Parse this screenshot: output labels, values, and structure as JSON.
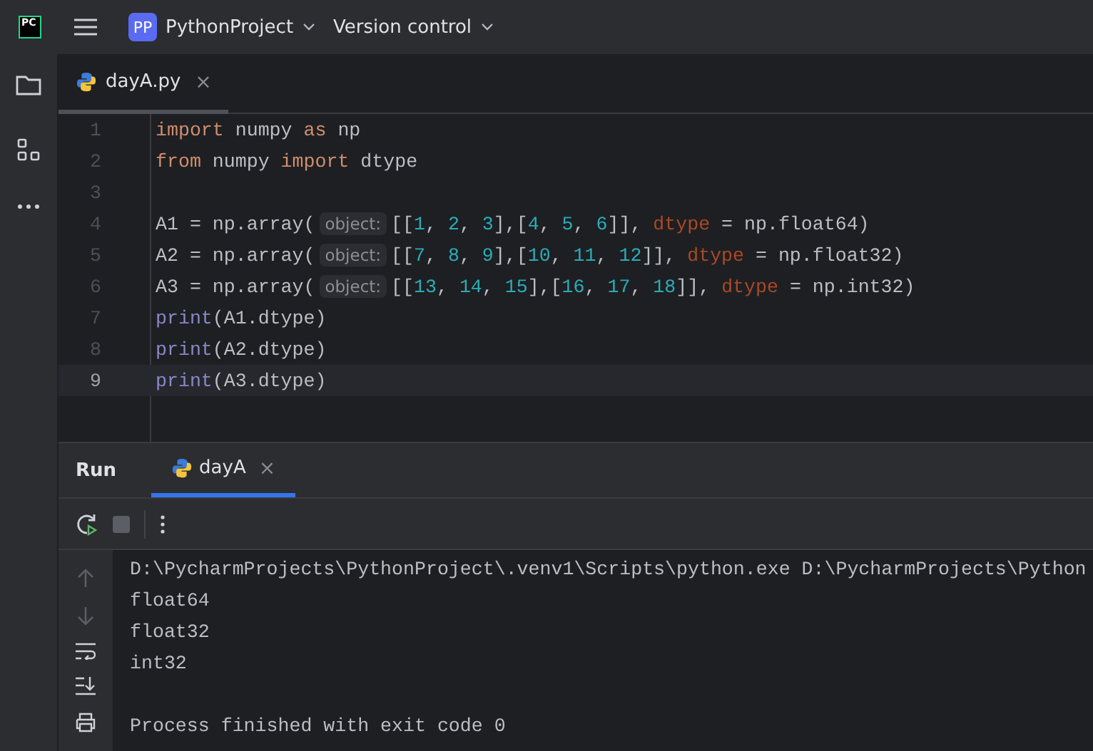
{
  "title_bar": {
    "logo": "PC",
    "project_badge": "PP",
    "project": "PythonProject",
    "vcs": "Version control"
  },
  "editor_tabs": [
    {
      "label": "dayA.py",
      "close": "×",
      "selected": true
    }
  ],
  "code_lines": [
    {
      "number": "1",
      "current": false,
      "tokens": [
        {
          "kind": "keyword",
          "text": "import"
        },
        {
          "kind": "plain",
          "text": " numpy "
        },
        {
          "kind": "keyword",
          "text": "as"
        },
        {
          "kind": "plain",
          "text": " np"
        }
      ]
    },
    {
      "number": "2",
      "current": false,
      "tokens": [
        {
          "kind": "keyword",
          "text": "from"
        },
        {
          "kind": "plain",
          "text": " numpy "
        },
        {
          "kind": "keyword",
          "text": "import"
        },
        {
          "kind": "plain",
          "text": " dtype"
        }
      ]
    },
    {
      "number": "3",
      "current": false
    },
    {
      "number": "4",
      "current": false,
      "tokens": [
        {
          "kind": "plain",
          "text": "A1 = np.array("
        },
        {
          "kind": "hint",
          "text": "object:"
        },
        {
          "kind": "plain",
          "text": "[["
        },
        {
          "kind": "number",
          "text": "1"
        },
        {
          "kind": "plain",
          "text": ", "
        },
        {
          "kind": "number",
          "text": "2"
        },
        {
          "kind": "plain",
          "text": ", "
        },
        {
          "kind": "number",
          "text": "3"
        },
        {
          "kind": "plain",
          "text": "],["
        },
        {
          "kind": "number",
          "text": "4"
        },
        {
          "kind": "plain",
          "text": ", "
        },
        {
          "kind": "number",
          "text": "5"
        },
        {
          "kind": "plain",
          "text": ", "
        },
        {
          "kind": "number",
          "text": "6"
        },
        {
          "kind": "plain",
          "text": "]], "
        },
        {
          "kind": "param",
          "text": "dtype"
        },
        {
          "kind": "plain",
          "text": " = np.float64)"
        }
      ]
    },
    {
      "number": "5",
      "current": false,
      "tokens": [
        {
          "kind": "plain",
          "text": "A2 = np.array("
        },
        {
          "kind": "hint",
          "text": "object:"
        },
        {
          "kind": "plain",
          "text": "[["
        },
        {
          "kind": "number",
          "text": "7"
        },
        {
          "kind": "plain",
          "text": ", "
        },
        {
          "kind": "number",
          "text": "8"
        },
        {
          "kind": "plain",
          "text": ", "
        },
        {
          "kind": "number",
          "text": "9"
        },
        {
          "kind": "plain",
          "text": "],["
        },
        {
          "kind": "number",
          "text": "10"
        },
        {
          "kind": "plain",
          "text": ", "
        },
        {
          "kind": "number",
          "text": "11"
        },
        {
          "kind": "plain",
          "text": ", "
        },
        {
          "kind": "number",
          "text": "12"
        },
        {
          "kind": "plain",
          "text": "]], "
        },
        {
          "kind": "param",
          "text": "dtype"
        },
        {
          "kind": "plain",
          "text": " = np.float32)"
        }
      ]
    },
    {
      "number": "6",
      "current": false,
      "tokens": [
        {
          "kind": "plain",
          "text": "A3 = np.array("
        },
        {
          "kind": "hint",
          "text": "object:"
        },
        {
          "kind": "plain",
          "text": "[["
        },
        {
          "kind": "number",
          "text": "13"
        },
        {
          "kind": "plain",
          "text": ", "
        },
        {
          "kind": "number",
          "text": "14"
        },
        {
          "kind": "plain",
          "text": ", "
        },
        {
          "kind": "number",
          "text": "15"
        },
        {
          "kind": "plain",
          "text": "],["
        },
        {
          "kind": "number",
          "text": "16"
        },
        {
          "kind": "plain",
          "text": ", "
        },
        {
          "kind": "number",
          "text": "17"
        },
        {
          "kind": "plain",
          "text": ", "
        },
        {
          "kind": "number",
          "text": "18"
        },
        {
          "kind": "plain",
          "text": "]], "
        },
        {
          "kind": "param",
          "text": "dtype"
        },
        {
          "kind": "plain",
          "text": " = np.int32)"
        }
      ]
    },
    {
      "number": "7",
      "current": false,
      "tokens": [
        {
          "kind": "builtin",
          "text": "print"
        },
        {
          "kind": "plain",
          "text": "(A1.dtype)"
        }
      ]
    },
    {
      "number": "8",
      "current": false,
      "tokens": [
        {
          "kind": "builtin",
          "text": "print"
        },
        {
          "kind": "plain",
          "text": "(A2.dtype)"
        }
      ]
    },
    {
      "number": "9",
      "current": true,
      "tokens": [
        {
          "kind": "builtin",
          "text": "print"
        },
        {
          "kind": "plain",
          "text": "(A3.dtype)"
        }
      ]
    }
  ],
  "run_panel": {
    "title": "Run",
    "tabs": [
      {
        "label": "dayA",
        "close": "×",
        "selected": true
      }
    ],
    "console": [
      {
        "kind": "output",
        "text": "D:\\PycharmProjects\\PythonProject\\.venv1\\Scripts\\python.exe D:\\PycharmProjects\\Python"
      },
      {
        "kind": "output",
        "text": "float64"
      },
      {
        "kind": "output",
        "text": "float32"
      },
      {
        "kind": "output",
        "text": "int32"
      },
      {
        "kind": "status",
        "text": "Process finished with exit code 0"
      }
    ]
  }
}
